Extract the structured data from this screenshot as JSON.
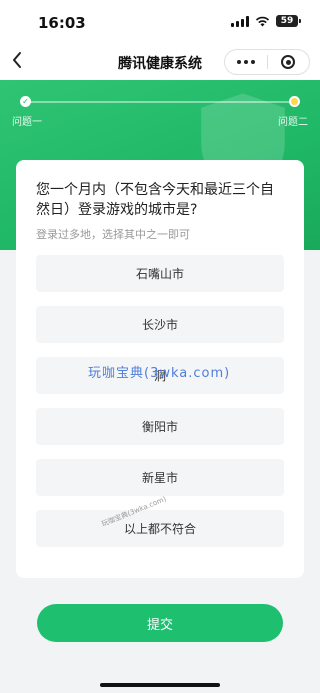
{
  "status_bar": {
    "time": "16:03",
    "battery": "59"
  },
  "nav": {
    "title": "腾讯健康系统"
  },
  "steps": {
    "step1_label": "问题一",
    "step2_label": "问题二",
    "step1_check": "✓"
  },
  "question": {
    "text": "您一个月内（不包含今天和最近三个自然日）登录游戏的城市是?",
    "hint": "登录过多地，选择其中之一即可"
  },
  "options": [
    {
      "label": "石嘴山市"
    },
    {
      "label": "长沙市"
    },
    {
      "label": "洞"
    },
    {
      "label": "衡阳市"
    },
    {
      "label": "新星市"
    },
    {
      "label": "以上都不符合"
    }
  ],
  "watermark": {
    "text": "玩咖宝典(3wka.com)",
    "small_text": "玩咖宝典(3wka.com)"
  },
  "submit": {
    "label": "提交"
  },
  "colors": {
    "primary_green": "#1fbf70",
    "step_active": "#ffd84a"
  }
}
